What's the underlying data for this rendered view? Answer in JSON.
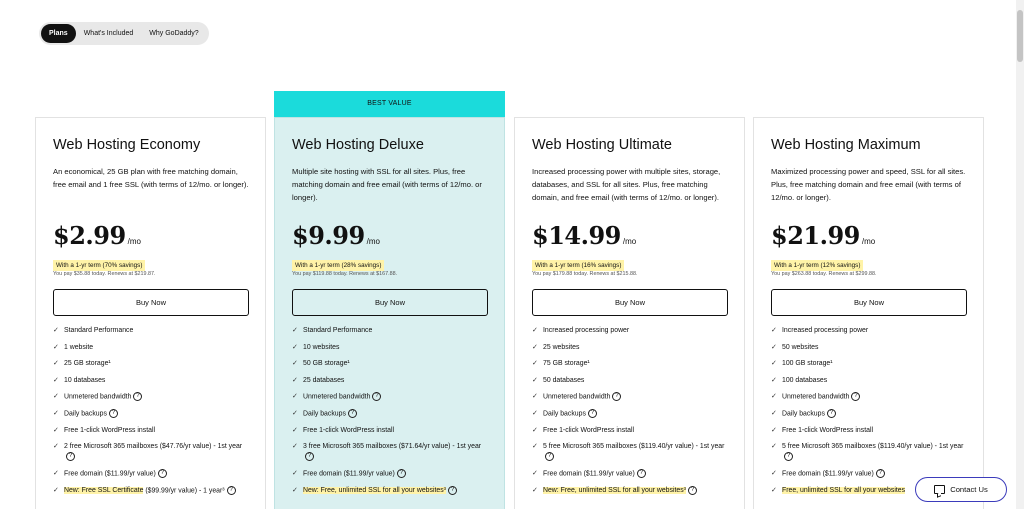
{
  "tabs": [
    {
      "label": "Plans",
      "active": true
    },
    {
      "label": "What's Included",
      "active": false
    },
    {
      "label": "Why GoDaddy?",
      "active": false
    }
  ],
  "badge": "BEST VALUE",
  "buy_label": "Buy Now",
  "contact_label": "Contact Us",
  "colors": {
    "badge": "#1bdbdb",
    "featured_bg": "#daf0f0",
    "highlight": "#fff3a8",
    "contact_border": "#3b3bbb"
  },
  "plans": [
    {
      "title": "Web Hosting Economy",
      "desc": "An economical, 25 GB plan with free matching domain, free email and 1 free SSL (with terms of 12/mo. or longer).",
      "price": "$2.99",
      "per": "/mo",
      "term": "With a 1-yr term (70% savings)",
      "renew": "You pay $35.88 today. Renews at $219.87.",
      "features": [
        {
          "text": "Standard Performance"
        },
        {
          "text": "1 website"
        },
        {
          "text": "25 GB storage¹"
        },
        {
          "text": "10 databases"
        },
        {
          "text": "Unmetered bandwidth",
          "help": true
        },
        {
          "text": "Daily backups",
          "help": true
        },
        {
          "text": "Free 1-click WordPress install"
        },
        {
          "text": "2 free Microsoft 365 mailboxes ($47.76/yr value) - 1st year",
          "help": true
        },
        {
          "text": "Free domain ($11.99/yr value)",
          "help": true
        },
        {
          "hl": "New: Free SSL Certificate",
          "text": " ($99.99/yr value) - 1 year³",
          "help": true
        }
      ]
    },
    {
      "title": "Web Hosting Deluxe",
      "desc": "Multiple site hosting with SSL for all sites. Plus, free matching domain and free email (with terms of 12/mo. or longer).",
      "price": "$9.99",
      "per": "/mo",
      "term": "With a 1-yr term (28% savings)",
      "renew": "You pay $119.88 today. Renews at $167.88.",
      "features": [
        {
          "text": "Standard Performance"
        },
        {
          "text": "10 websites"
        },
        {
          "text": "50 GB storage¹"
        },
        {
          "text": "25 databases"
        },
        {
          "text": "Unmetered bandwidth",
          "help": true
        },
        {
          "text": "Daily backups",
          "help": true
        },
        {
          "text": "Free 1-click WordPress install"
        },
        {
          "text": "3 free Microsoft 365 mailboxes ($71.64/yr value) - 1st year",
          "help": true
        },
        {
          "text": "Free domain ($11.99/yr value)",
          "help": true
        },
        {
          "hl": "New: Free, unlimited SSL for all your websites³",
          "text": "",
          "help": true
        }
      ]
    },
    {
      "title": "Web Hosting Ultimate",
      "desc": "Increased processing power with multiple sites, storage, databases, and SSL for all sites. Plus, free matching domain, and free email (with terms of 12/mo. or longer).",
      "price": "$14.99",
      "per": "/mo",
      "term": "With a 1-yr term (16% savings)",
      "renew": "You pay $179.88 today. Renews at $215.88.",
      "features": [
        {
          "text": "Increased processing power"
        },
        {
          "text": "25 websites"
        },
        {
          "text": "75 GB storage¹"
        },
        {
          "text": "50 databases"
        },
        {
          "text": "Unmetered bandwidth",
          "help": true
        },
        {
          "text": "Daily backups",
          "help": true
        },
        {
          "text": "Free 1-click WordPress install"
        },
        {
          "text": "5 free Microsoft 365 mailboxes ($119.40/yr value) - 1st year",
          "help": true
        },
        {
          "text": "Free domain ($11.99/yr value)",
          "help": true
        },
        {
          "hl": "New: Free, unlimited SSL for all your websites³",
          "text": "",
          "help": true
        }
      ]
    },
    {
      "title": "Web Hosting Maximum",
      "desc": "Maximized processing power and speed, SSL for all sites. Plus, free matching domain and free email (with terms of 12/mo. or longer).",
      "price": "$21.99",
      "per": "/mo",
      "term": "With a 1-yr term (12% savings)",
      "renew": "You pay $263.88 today. Renews at $299.88.",
      "features": [
        {
          "text": "Increased processing power"
        },
        {
          "text": "50 websites"
        },
        {
          "text": "100 GB storage¹"
        },
        {
          "text": "100 databases"
        },
        {
          "text": "Unmetered bandwidth",
          "help": true
        },
        {
          "text": "Daily backups",
          "help": true
        },
        {
          "text": "Free 1-click WordPress install"
        },
        {
          "text": "5 free Microsoft 365 mailboxes ($119.40/yr value) - 1st year",
          "help": true
        },
        {
          "text": "Free domain ($11.99/yr value)",
          "help": true
        },
        {
          "hl": "Free, unlimited SSL for all your websites",
          "text": "",
          "help": false
        }
      ]
    }
  ]
}
